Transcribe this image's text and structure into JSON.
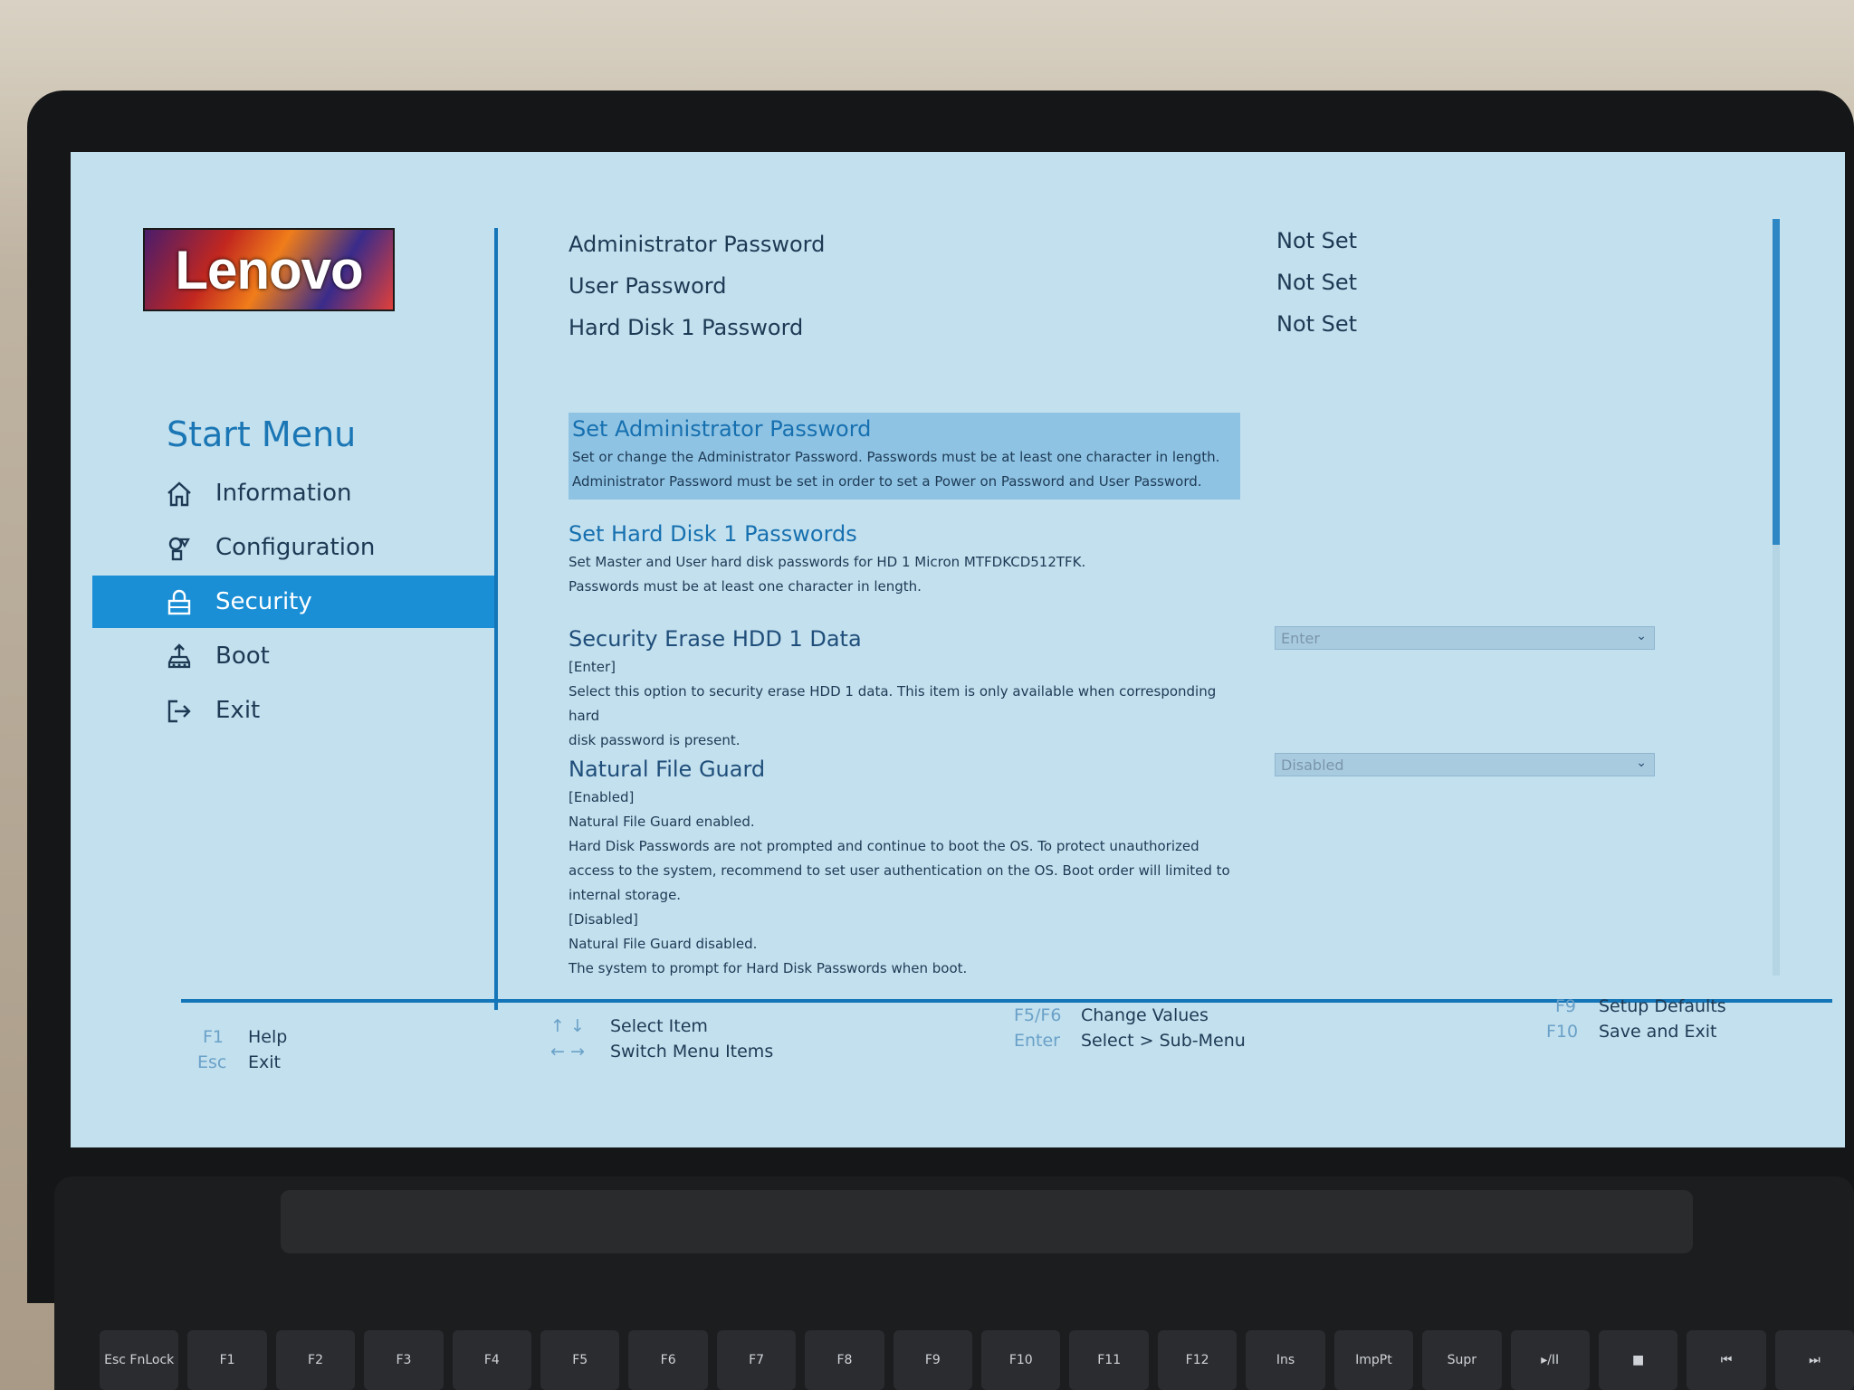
{
  "brand": "Lenovo",
  "start_menu_title": "Start Menu",
  "nav": [
    {
      "label": "Information",
      "icon": "home-icon",
      "active": false
    },
    {
      "label": "Configuration",
      "icon": "configuration-icon",
      "active": false
    },
    {
      "label": "Security",
      "icon": "lock-icon",
      "active": true
    },
    {
      "label": "Boot",
      "icon": "boot-icon",
      "active": false
    },
    {
      "label": "Exit",
      "icon": "exit-icon",
      "active": false
    }
  ],
  "passwords": [
    {
      "label": "Administrator Password",
      "value": "Not Set"
    },
    {
      "label": "User Password",
      "value": "Not Set"
    },
    {
      "label": "Hard Disk 1 Password",
      "value": "Not Set"
    }
  ],
  "items": {
    "set_admin": {
      "title": "Set Administrator Password",
      "desc1": "Set or change the Administrator Password. Passwords must be at least one character in length.",
      "desc2": "Administrator Password must be set in order to set a Power on Password and User Password."
    },
    "set_hdd": {
      "title": "Set Hard Disk 1 Passwords",
      "desc1": "Set Master and User hard disk passwords for HD 1 Micron MTFDKCD512TFK.",
      "desc2": "Passwords must be at least one character in length."
    },
    "erase": {
      "title": "Security Erase HDD 1 Data",
      "opt": "[Enter]",
      "desc1": "Select this option to security erase HDD 1 data. This item is only available when corresponding hard",
      "desc2": "disk password is present.",
      "value": "Enter"
    },
    "nfg": {
      "title": "Natural File Guard",
      "l1": "[Enabled]",
      "l2": "Natural File Guard enabled.",
      "l3": "Hard Disk Passwords are not prompted and continue to boot the OS. To protect unauthorized",
      "l4": "access to the system,  recommend to set user authentication on the OS. Boot order will limited to",
      "l5": "internal storage.",
      "l6": "[Disabled]",
      "l7": "Natural File Guard disabled.",
      "l8": "The system to prompt for Hard Disk Passwords when boot.",
      "value": "Disabled"
    }
  },
  "footer": {
    "f1_key": "F1",
    "f1_label": "Help",
    "esc_key": "Esc",
    "esc_label": "Exit",
    "updown_key": "↑ ↓",
    "updown_label": "Select Item",
    "leftright_key": "← →",
    "leftright_label": "Switch Menu Items",
    "f5f6_key": "F5/F6",
    "f5f6_label": "Change Values",
    "enter_key": "Enter",
    "enter_label": "Select > Sub-Menu",
    "f9_key": "F9",
    "f9_label": "Setup Defaults",
    "f10_key": "F10",
    "f10_label": "Save and Exit"
  },
  "keyboard": [
    "Esc FnLock",
    "F1",
    "F2",
    "F3",
    "F4",
    "F5",
    "F6",
    "F7",
    "F8",
    "F9",
    "F10",
    "F11",
    "F12",
    "Ins",
    "ImpPt",
    "Supr",
    "▸/II",
    "■",
    "⏮",
    "⏭"
  ],
  "colors": {
    "screen_bg": "#c3e0ee",
    "accent": "#1a8fd6",
    "text": "#1d3a55"
  }
}
